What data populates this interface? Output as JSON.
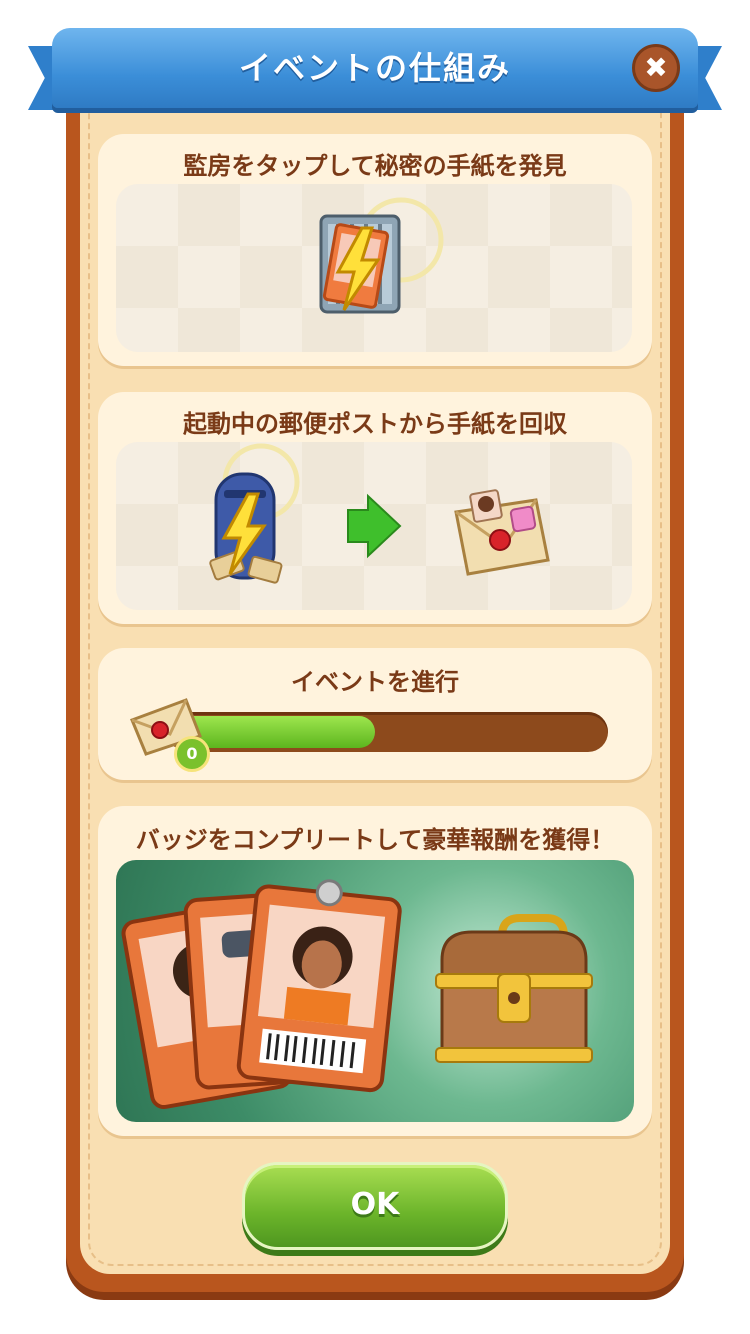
{
  "dialog": {
    "title": "イベントの仕組み",
    "close_label": "✖"
  },
  "steps": [
    {
      "text": "監房をタップして秘密の手紙を発見",
      "icon": "cell-door-icon"
    },
    {
      "text": "起動中の郵便ポストから手紙を回収",
      "icons": [
        "mailbox-icon",
        "arrow-right-icon",
        "letter-icon"
      ]
    },
    {
      "text": "イベントを進行",
      "progress": {
        "value": 0,
        "value_label": "0",
        "fill_fraction": 0.47
      }
    },
    {
      "text": "バッジをコンプリートして豪華報酬を獲得！",
      "icons": [
        "badge-cards-icon",
        "treasure-chest-icon"
      ]
    }
  ],
  "footer": {
    "ok_label": "OK"
  },
  "colors": {
    "ribbon": "#3b8ed8",
    "panel_border": "#b9561e",
    "panel_fill": "#f9dfb2",
    "text_brown": "#7a3a17",
    "button_green": "#6bb42a"
  }
}
